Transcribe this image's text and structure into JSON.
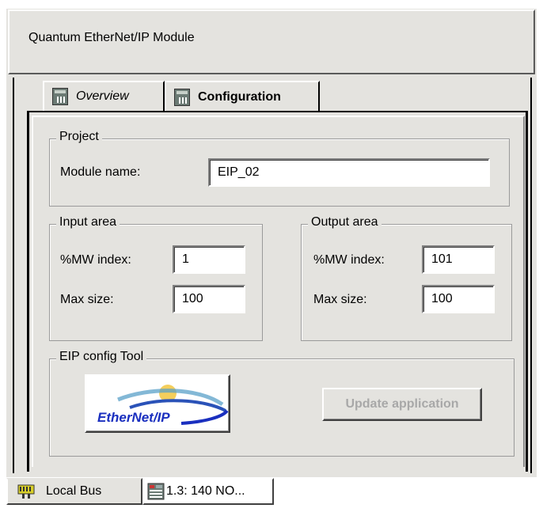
{
  "window": {
    "title": "Quantum EtherNet/IP Module"
  },
  "tabs": [
    {
      "label": "Overview",
      "active": false
    },
    {
      "label": "Configuration",
      "active": true
    }
  ],
  "project": {
    "legend": "Project",
    "module_name_label": "Module name:",
    "module_name_value": "EIP_02"
  },
  "input_area": {
    "legend": "Input area",
    "mw_index_label": "%MW index:",
    "mw_index_value": "1",
    "max_size_label": "Max size:",
    "max_size_value": "100"
  },
  "output_area": {
    "legend": "Output area",
    "mw_index_label": "%MW index:",
    "mw_index_value": "101",
    "max_size_label": "Max size:",
    "max_size_value": "100"
  },
  "eip_tool": {
    "legend": "EIP config Tool",
    "logo_text": "EtherNet/IP",
    "update_button": "Update application"
  },
  "bottom_tabs": [
    {
      "label": "Local Bus",
      "icon": "bus-icon"
    },
    {
      "label": "1.3: 140 NO...",
      "icon": "module-icon"
    }
  ],
  "colors": {
    "panel": "#e4e3df",
    "disabled_text": "#a8a8a8",
    "logo_blue": "#1a2fbf"
  }
}
